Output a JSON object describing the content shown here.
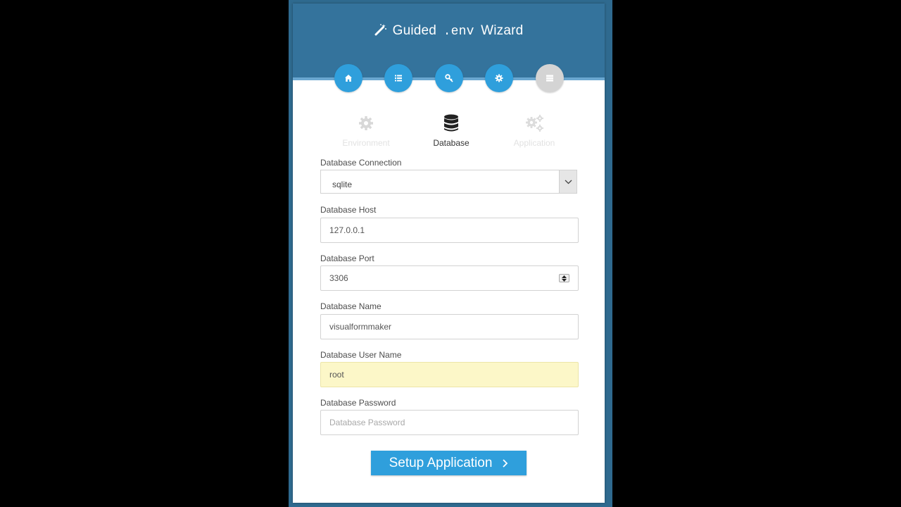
{
  "header": {
    "title_prefix": "Guided",
    "title_env": ".env",
    "title_suffix": "Wizard",
    "wand_icon": "magic-wand-icon"
  },
  "steps": [
    {
      "icon": "home-icon",
      "state": "active"
    },
    {
      "icon": "list-icon",
      "state": "active"
    },
    {
      "icon": "key-icon",
      "state": "active"
    },
    {
      "icon": "gear-icon",
      "state": "active"
    },
    {
      "icon": "server-icon",
      "state": "done"
    }
  ],
  "tabs": [
    {
      "label": "Environment",
      "icon": "gear-icon",
      "active": false
    },
    {
      "label": "Database",
      "icon": "database-icon",
      "active": true
    },
    {
      "label": "Application",
      "icon": "gears-icon",
      "active": false
    }
  ],
  "form": {
    "connection": {
      "label": "Database Connection",
      "value": "sqlite"
    },
    "host": {
      "label": "Database Host",
      "value": "127.0.0.1"
    },
    "port": {
      "label": "Database Port",
      "value": "3306"
    },
    "name": {
      "label": "Database Name",
      "value": "visualformmaker"
    },
    "username": {
      "label": "Database User Name",
      "value": "root"
    },
    "password": {
      "label": "Database Password",
      "placeholder": "Database Password",
      "value": ""
    }
  },
  "submit": {
    "label": "Setup Application"
  },
  "colors": {
    "header": "#34739c",
    "accent": "#2f9fdc",
    "frame": "#2f6a8f",
    "autofill": "#fcf7c8"
  }
}
